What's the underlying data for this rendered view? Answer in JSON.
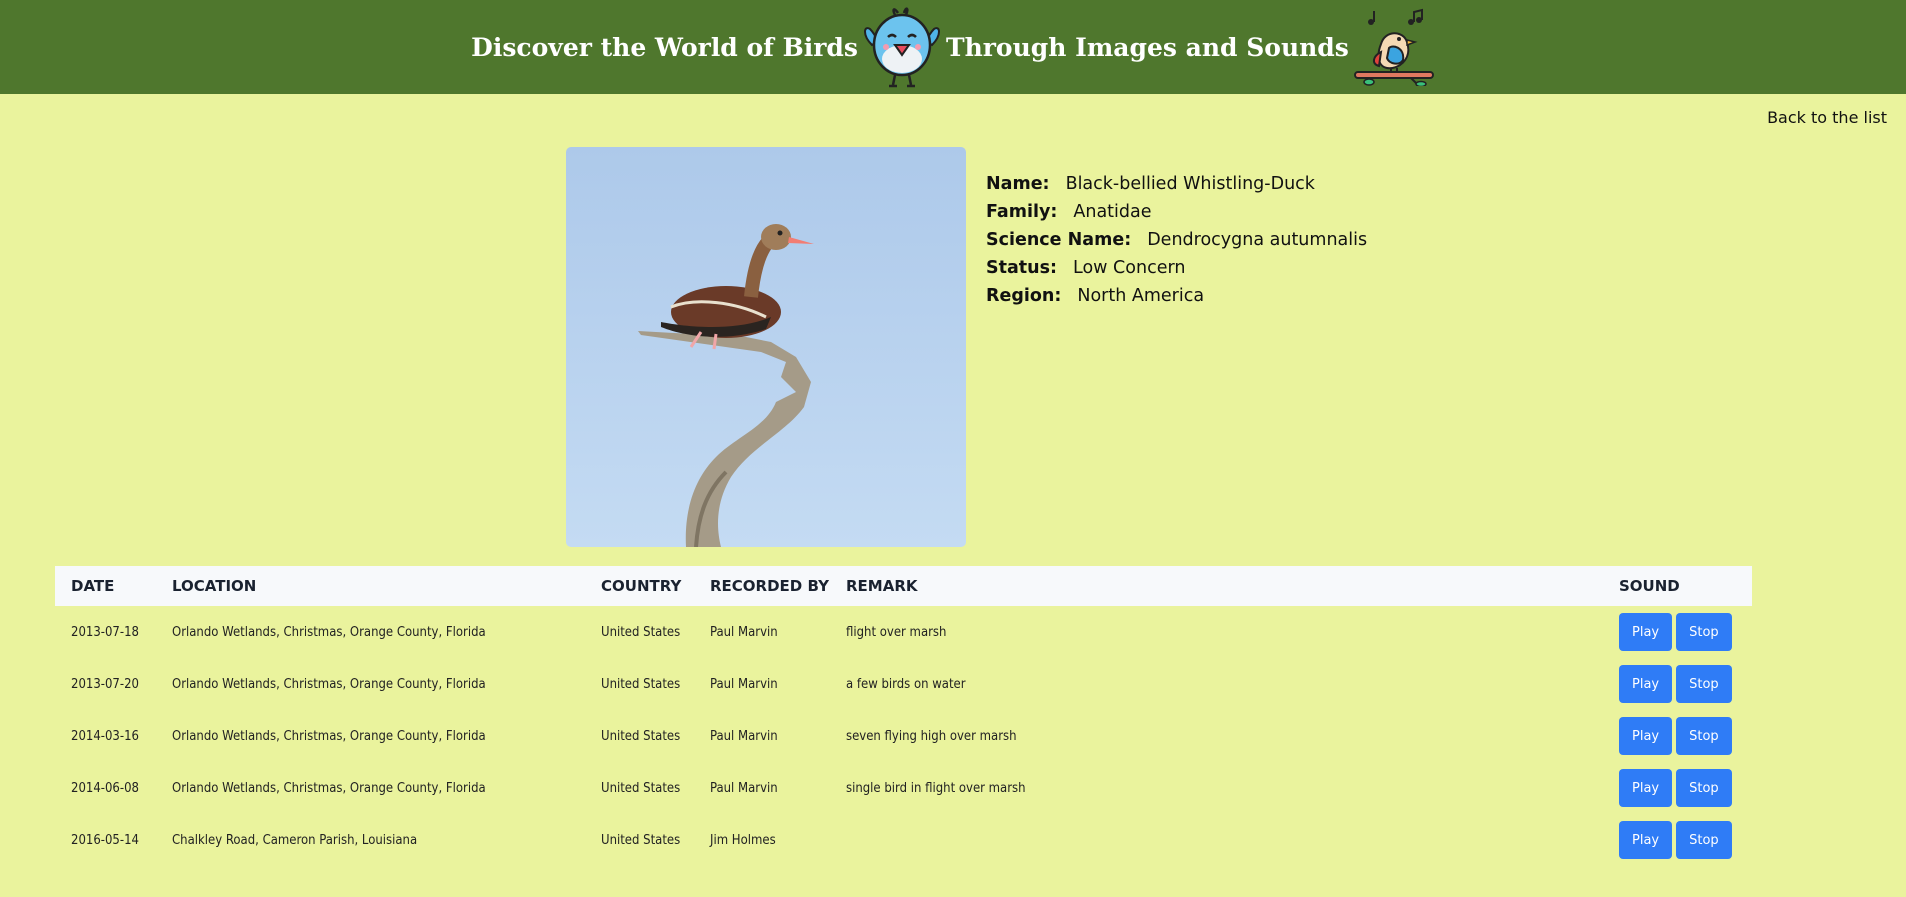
{
  "header": {
    "title_part1": "Discover the World of Birds",
    "title_part2": "Through Images and Sounds",
    "icon1": "blue-bird-icon",
    "icon2": "singing-bird-on-branch-icon",
    "background": "#4f772d"
  },
  "nav": {
    "back_label": "Back to the list"
  },
  "bird": {
    "photo_description_icon": "bird-photo",
    "fields": [
      {
        "label": "Name:",
        "value": "Black-bellied Whistling-Duck"
      },
      {
        "label": "Family:",
        "value": "Anatidae"
      },
      {
        "label": "Science Name:",
        "value": "Dendrocygna autumnalis"
      },
      {
        "label": "Status:",
        "value": "Low Concern"
      },
      {
        "label": "Region:",
        "value": "North America"
      }
    ]
  },
  "table": {
    "headers": [
      "DATE",
      "LOCATION",
      "COUNTRY",
      "RECORDED BY",
      "REMARK",
      "SOUND"
    ],
    "play_label": "Play",
    "stop_label": "Stop",
    "rows": [
      {
        "date": "2013-07-18",
        "location": "Orlando Wetlands, Christmas, Orange County, Florida",
        "country": "United States",
        "recorded_by": "Paul Marvin",
        "remark": "flight over marsh"
      },
      {
        "date": "2013-07-20",
        "location": "Orlando Wetlands, Christmas, Orange County, Florida",
        "country": "United States",
        "recorded_by": "Paul Marvin",
        "remark": "a few birds on water"
      },
      {
        "date": "2014-03-16",
        "location": "Orlando Wetlands, Christmas, Orange County, Florida",
        "country": "United States",
        "recorded_by": "Paul Marvin",
        "remark": "seven flying high over marsh"
      },
      {
        "date": "2014-06-08",
        "location": "Orlando Wetlands, Christmas, Orange County, Florida",
        "country": "United States",
        "recorded_by": "Paul Marvin",
        "remark": "single bird in flight over marsh"
      },
      {
        "date": "2016-05-14",
        "location": "Chalkley Road, Cameron Parish, Louisiana",
        "country": "United States",
        "recorded_by": "Jim Holmes",
        "remark": ""
      }
    ]
  },
  "colors": {
    "page_background": "#eaf39d",
    "button": "#2f7cf6",
    "table_header_background": "#f7f9fb"
  }
}
